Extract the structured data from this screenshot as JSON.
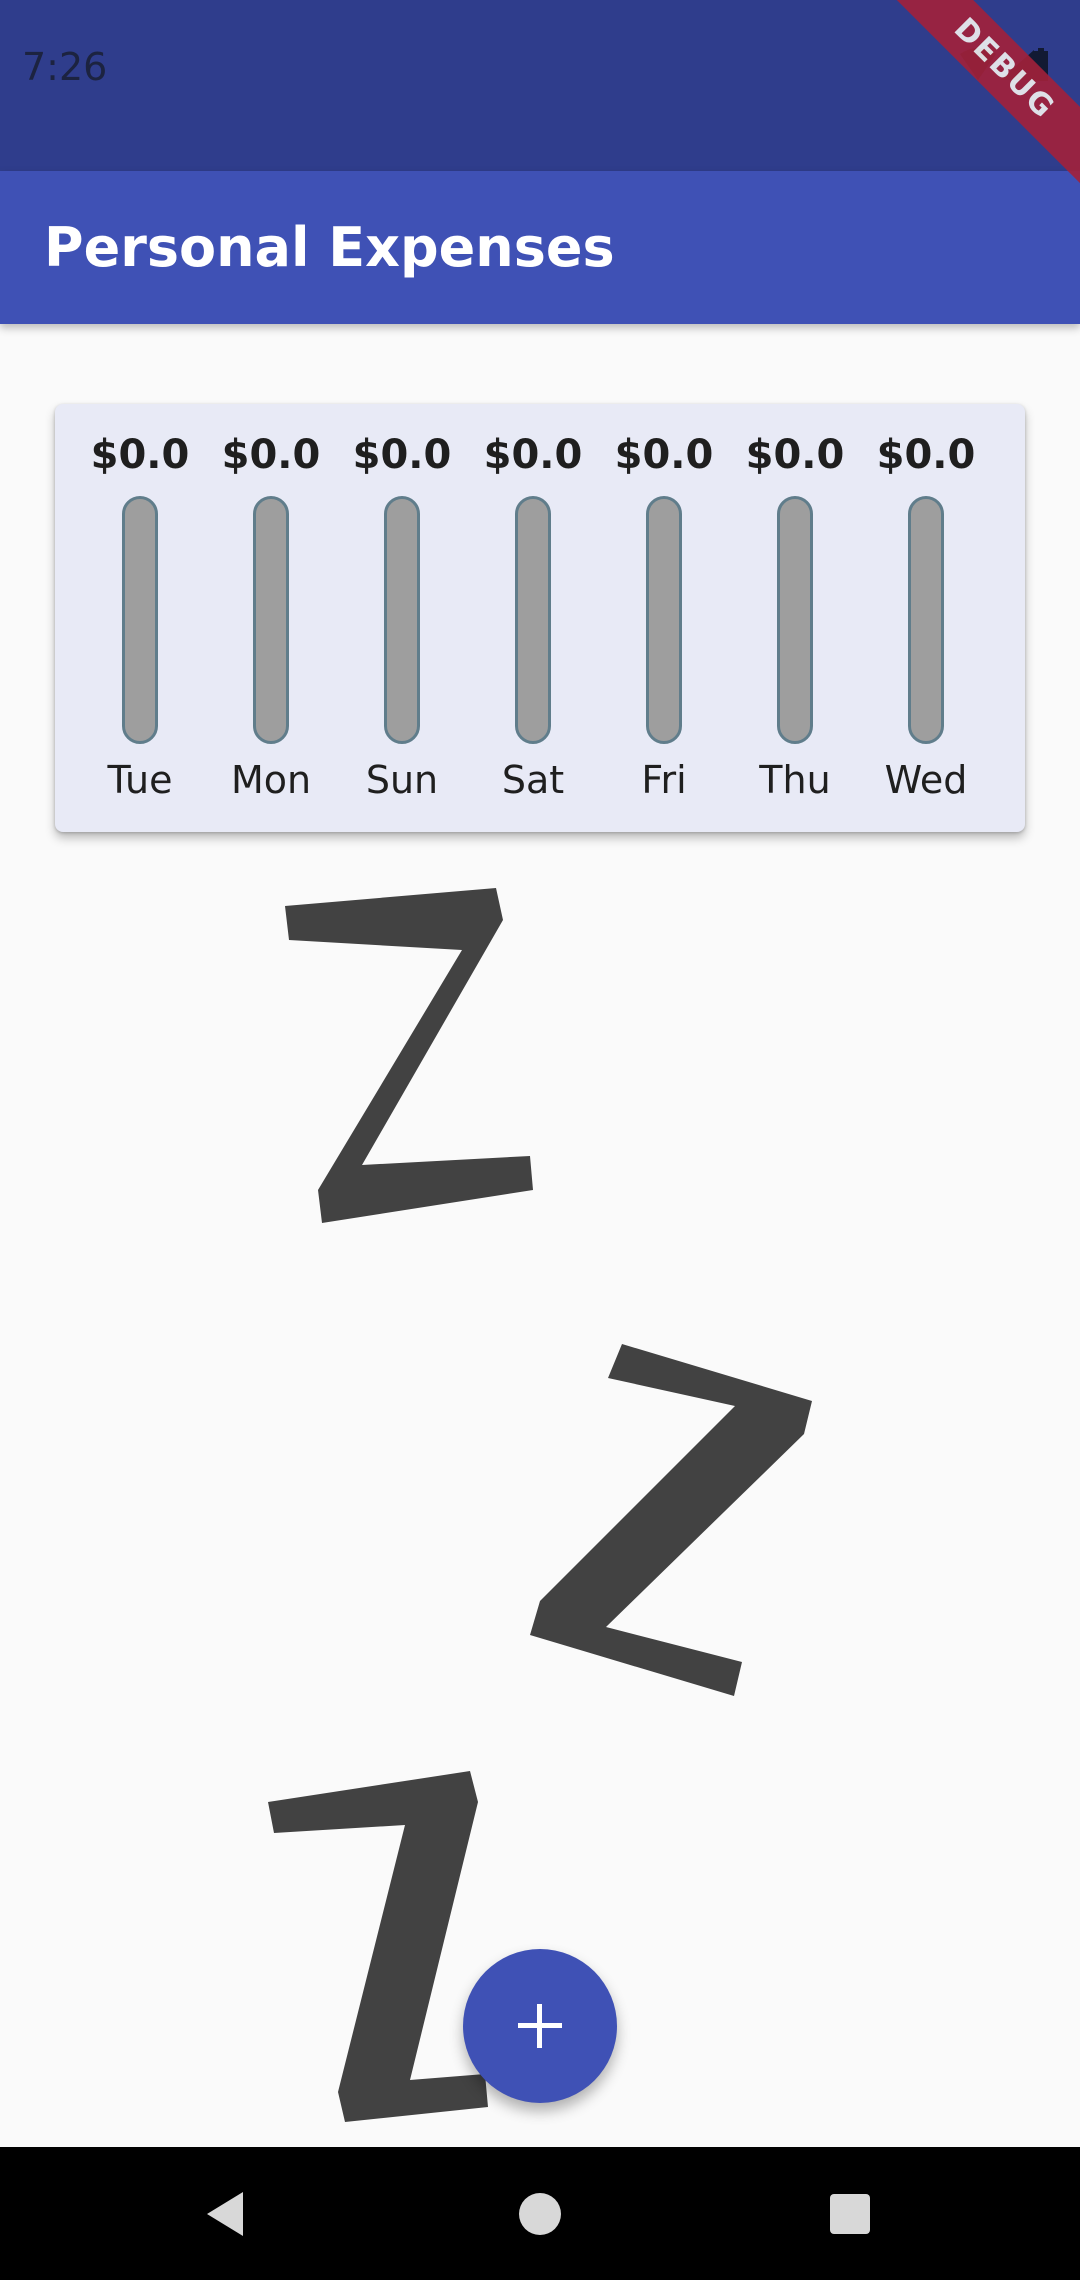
{
  "status_bar": {
    "time": "7:26",
    "icons": [
      "wifi-icon",
      "signal-icon",
      "battery-icon"
    ]
  },
  "debug_banner": {
    "label": "DEBUG"
  },
  "app_bar": {
    "title": "Personal Expenses"
  },
  "chart": {
    "bars": [
      {
        "day": "Tue",
        "amount": "$0.0",
        "fraction": 0
      },
      {
        "day": "Mon",
        "amount": "$0.0",
        "fraction": 0
      },
      {
        "day": "Sun",
        "amount": "$0.0",
        "fraction": 0
      },
      {
        "day": "Sat",
        "amount": "$0.0",
        "fraction": 0
      },
      {
        "day": "Fri",
        "amount": "$0.0",
        "fraction": 0
      },
      {
        "day": "Thu",
        "amount": "$0.0",
        "fraction": 0
      },
      {
        "day": "Wed",
        "amount": "$0.0",
        "fraction": 0
      }
    ]
  },
  "empty_state": {
    "icon": "sleeping-zzz-icon"
  },
  "fab": {
    "icon": "plus-icon"
  },
  "nav_bar": {
    "icons": [
      "back-icon",
      "home-icon",
      "recents-icon"
    ]
  },
  "colors": {
    "primary": "#3f51b5",
    "primary_dark": "#2f3d8c",
    "card_background": "#e8eaf6",
    "bar_empty": "#9e9e9e",
    "debug_banner": "#a3213a"
  }
}
